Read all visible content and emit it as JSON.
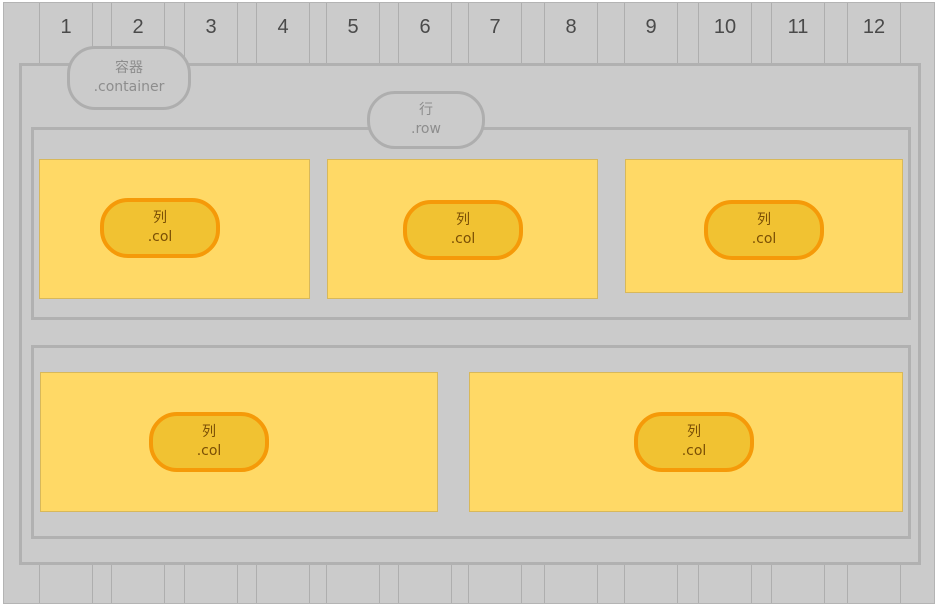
{
  "grid": {
    "columns": [
      "1",
      "2",
      "3",
      "4",
      "5",
      "6",
      "7",
      "8",
      "9",
      "10",
      "11",
      "12"
    ]
  },
  "container_label": {
    "title": "容器",
    "class": ".container"
  },
  "row_label": {
    "title": "行",
    "class": ".row"
  },
  "row1": {
    "cols": [
      {
        "title": "列",
        "class": ".col"
      },
      {
        "title": "列",
        "class": ".col"
      },
      {
        "title": "列",
        "class": ".col"
      }
    ]
  },
  "row2": {
    "cols": [
      {
        "title": "列",
        "class": ".col"
      },
      {
        "title": "列",
        "class": ".col"
      }
    ]
  },
  "colors": {
    "background": "#cbcbcb",
    "column_fill": "#ffd966",
    "pill_orange_fill": "#f1c232",
    "pill_orange_border": "#f59a09",
    "gray_border": "#aeaeae"
  }
}
